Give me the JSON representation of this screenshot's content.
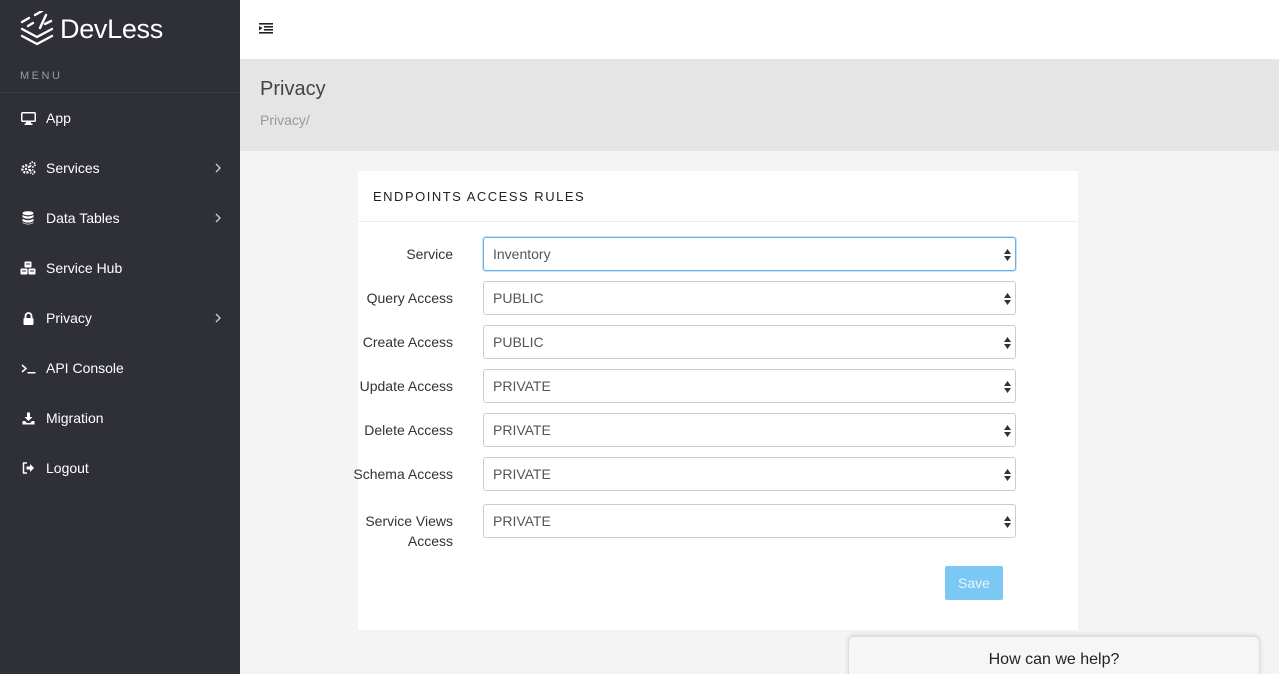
{
  "brand": {
    "name": "DevLess"
  },
  "sidebar": {
    "menu_title": "MENU",
    "items": [
      {
        "label": "App",
        "icon": "monitor-icon",
        "has_submenu": false
      },
      {
        "label": "Services",
        "icon": "gears-icon",
        "has_submenu": true
      },
      {
        "label": "Data Tables",
        "icon": "database-icon",
        "has_submenu": true
      },
      {
        "label": "Service Hub",
        "icon": "cubes-icon",
        "has_submenu": false
      },
      {
        "label": "Privacy",
        "icon": "lock-icon",
        "has_submenu": true
      },
      {
        "label": "API Console",
        "icon": "terminal-icon",
        "has_submenu": false
      },
      {
        "label": "Migration",
        "icon": "download-icon",
        "has_submenu": false
      },
      {
        "label": "Logout",
        "icon": "sign-out-icon",
        "has_submenu": false
      }
    ]
  },
  "header": {
    "title": "Privacy",
    "breadcrumb": "Privacy/"
  },
  "panel": {
    "heading": "ENDPOINTS ACCESS RULES",
    "fields": [
      {
        "label": "Service",
        "value": "Inventory"
      },
      {
        "label": "Query Access",
        "value": "PUBLIC"
      },
      {
        "label": "Create Access",
        "value": "PUBLIC"
      },
      {
        "label": "Update Access",
        "value": "PRIVATE"
      },
      {
        "label": "Delete Access",
        "value": "PRIVATE"
      },
      {
        "label": "Schema Access",
        "value": "PRIVATE"
      },
      {
        "label": "Service Views Access",
        "value": "PRIVATE"
      }
    ],
    "save_label": "Save"
  },
  "help_widget": {
    "label": "How can we help?"
  },
  "colors": {
    "sidebar_bg": "#2f2f37",
    "header_bg": "#e5e5e5",
    "accent": "#7cc8f5",
    "focus_border": "#66afe9"
  }
}
